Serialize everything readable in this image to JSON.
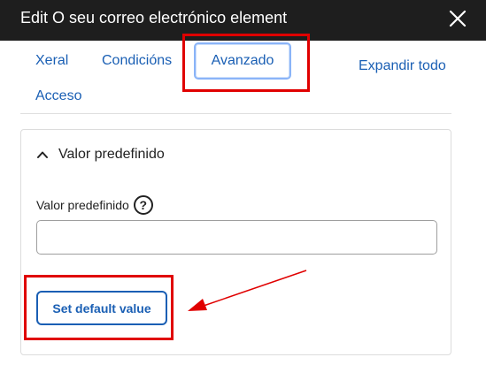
{
  "window": {
    "title": "Edit O seu correo electrónico element",
    "close_icon": "close-icon"
  },
  "tabs": [
    {
      "label": "Xeral",
      "active": false
    },
    {
      "label": "Condicións",
      "active": false
    },
    {
      "label": "Avanzado",
      "active": true
    },
    {
      "label": "Acceso",
      "active": false
    }
  ],
  "expand_all": "Expandir todo",
  "panel": {
    "title": "Valor predefinido",
    "expanded": true,
    "chevron_icon": "chevron-up-icon",
    "field": {
      "label": "Valor predefinido",
      "help_icon": "help-circle-icon",
      "help_glyph": "?",
      "value": "",
      "placeholder": ""
    },
    "button_label": "Set default value"
  },
  "colors": {
    "titlebar": "#1e1e1e",
    "link": "#1a5fb4",
    "annotation": "#e00000"
  }
}
